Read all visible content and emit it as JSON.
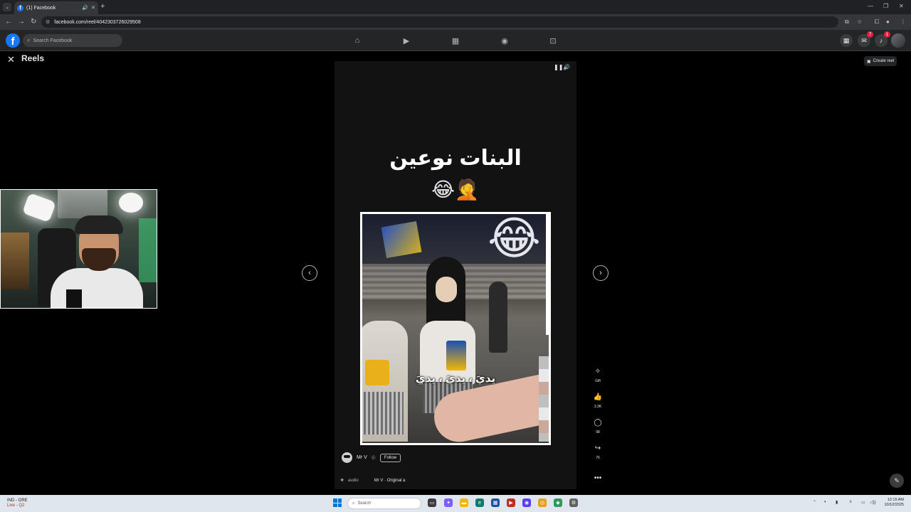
{
  "browser": {
    "tab_title": "(1) Facebook",
    "tab_favicon": "facebook-icon",
    "new_tab_label": "+",
    "url": "facebook.com/reel/4042303726029508",
    "window_controls": [
      "minimize-icon",
      "restore-icon",
      "close-icon"
    ]
  },
  "fb_nav": {
    "logo_letter": "f",
    "search_placeholder": "Search Facebook",
    "tabs": [
      "home-icon",
      "video-icon",
      "marketplace-icon",
      "groups-icon",
      "gaming-icon"
    ],
    "messenger_badge": "7",
    "notifications_badge": "1",
    "accent": "#1877f2"
  },
  "reels": {
    "title": "Reels",
    "create_reel": "Create reel"
  },
  "reel": {
    "caption": "البنات نوعين",
    "caption_emoji": "😂🤦",
    "overlay_emoji": "😂",
    "subtitle": "يديَ ، يديَ ، يديَ",
    "author": "Mr V",
    "follow_label": "Follow",
    "audio_label": "audio",
    "audio_track": "Mr V · Original a",
    "actions": {
      "gift": "Gift",
      "likes": "3.3K",
      "comments": "98",
      "shares": "76"
    }
  },
  "taskbar": {
    "weather_line1": "IND - ORE",
    "weather_line2": "Live - Q2",
    "search_placeholder": "Search",
    "time": "12:15 AM",
    "date": "10/12/2025"
  }
}
